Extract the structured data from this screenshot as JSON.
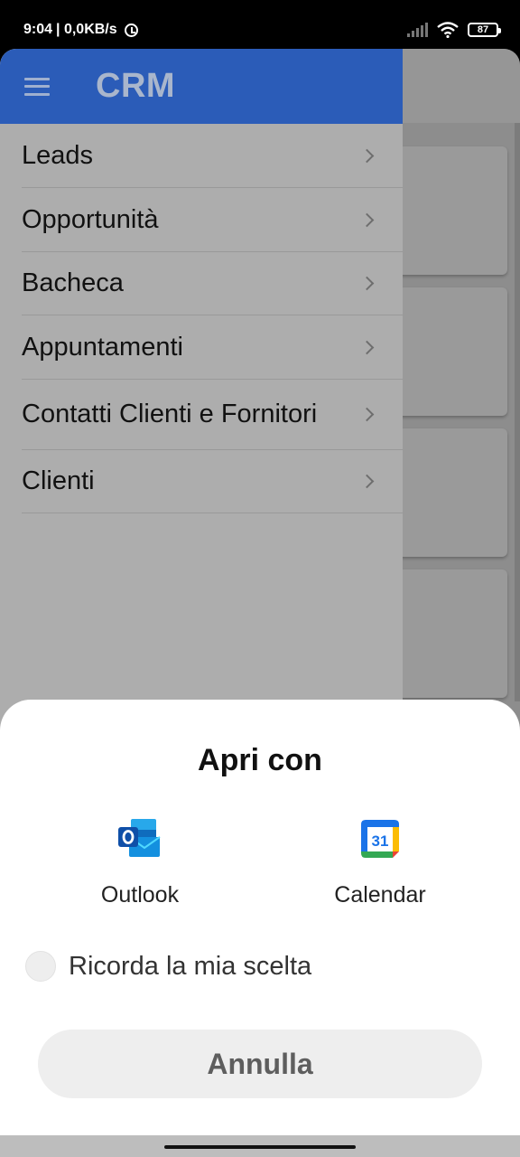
{
  "status_bar": {
    "time": "9:04",
    "speed": "| 0,0KB/s",
    "battery": "87"
  },
  "drawer": {
    "title": "CRM",
    "items": [
      {
        "label": "Leads"
      },
      {
        "label": "Opportunità"
      },
      {
        "label": "Bacheca"
      },
      {
        "label": "Appuntamenti"
      },
      {
        "label": "Contatti Clienti e Fornitori"
      },
      {
        "label": "Clienti"
      }
    ]
  },
  "sheet": {
    "title": "Apri con",
    "apps": [
      {
        "name": "Outlook",
        "icon": "outlook-icon"
      },
      {
        "name": "Calendar",
        "icon": "google-calendar-icon",
        "icon_text": "31"
      }
    ],
    "remember_label": "Ricorda la mia scelta",
    "cancel_label": "Annulla"
  },
  "colors": {
    "header_blue": "#2b5cb8",
    "outlook_blue": "#0f6cbd",
    "calendar_blue": "#1a73e8"
  }
}
